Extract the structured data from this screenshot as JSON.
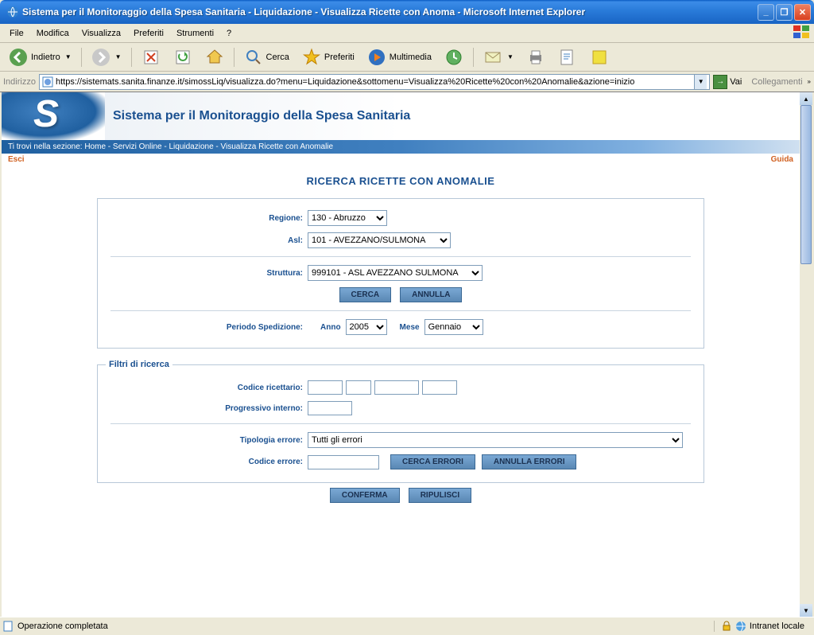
{
  "window": {
    "title": "Sistema per il Monitoraggio della Spesa Sanitaria - Liquidazione - Visualizza Ricette con Anoma - Microsoft Internet Explorer"
  },
  "menu": {
    "file": "File",
    "modifica": "Modifica",
    "visualizza": "Visualizza",
    "preferiti": "Preferiti",
    "strumenti": "Strumenti",
    "help": "?"
  },
  "toolbar": {
    "indietro": "Indietro",
    "cerca": "Cerca",
    "preferiti": "Preferiti",
    "multimedia": "Multimedia"
  },
  "addr": {
    "label": "Indirizzo",
    "url": "https://sistemats.sanita.finanze.it/simossLiq/visualizza.do?menu=Liquidazione&sottomenu=Visualizza%20Ricette%20con%20Anomalie&azione=inizio",
    "go": "Vai",
    "collegamenti": "Collegamenti"
  },
  "page": {
    "systemTitle": "Sistema per il Monitoraggio della Spesa Sanitaria",
    "breadcrumb": "Ti trovi nella sezione: Home - Servizi Online - Liquidazione - Visualizza Ricette con Anomalie",
    "esci": "Esci",
    "guida": "Guida",
    "heading": "RICERCA RICETTE CON ANOMALIE"
  },
  "form": {
    "regione_lbl": "Regione:",
    "regione_val": "130 - Abruzzo",
    "asl_lbl": "Asl:",
    "asl_val": "101 - AVEZZANO/SULMONA",
    "struttura_lbl": "Struttura:",
    "struttura_val": "999101 - ASL AVEZZANO SULMONA",
    "cerca": "CERCA",
    "annulla": "ANNULLA",
    "periodo_lbl": "Periodo Spedizione:",
    "anno_lbl": "Anno",
    "anno_val": "2005",
    "mese_lbl": "Mese",
    "mese_val": "Gennaio",
    "filtri_legend": "Filtri di ricerca",
    "codric_lbl": "Codice ricettario:",
    "progint_lbl": "Progressivo interno:",
    "tipoerr_lbl": "Tipologia errore:",
    "tipoerr_val": "Tutti gli errori",
    "coderr_lbl": "Codice errore:",
    "cercaerr": "CERCA ERRORI",
    "annerr": "ANNULLA ERRORI",
    "conferma": "CONFERMA",
    "ripulisci": "RIPULISCI"
  },
  "status": {
    "left": "Operazione completata",
    "right": "Intranet locale"
  }
}
